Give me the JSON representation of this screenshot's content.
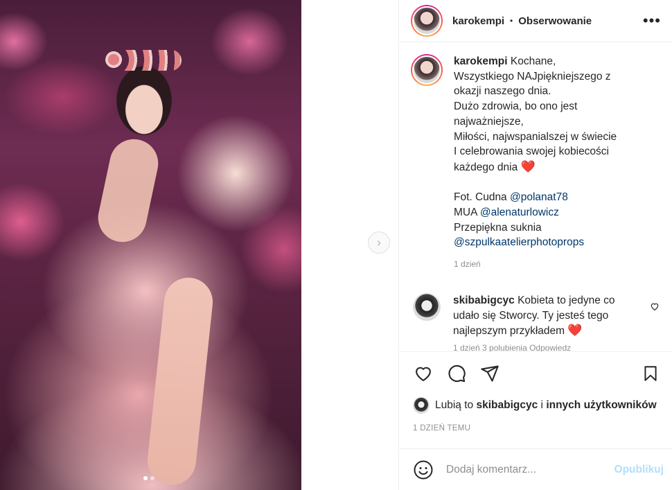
{
  "post": {
    "author": "karokempi",
    "follow_label": "Obserwowanie",
    "separator": "•",
    "more": "•••",
    "caption_lines": [
      "Kochane,",
      "Wszystkiego NAJpiękniejszego z",
      "okazji naszego dnia.",
      "Dużo zdrowia, bo ono jest",
      "najważniejsze,",
      "Miłości, najwspanialszej w świecie",
      "I celebrowania swojej kobiecości",
      "każdego dnia"
    ],
    "heart_emoji": "❤️",
    "credits": {
      "photo_prefix": "Fot. Cudna",
      "photo_mention": "@polanat78",
      "mua_prefix": "MUA",
      "mua_mention": "@alenaturlowicz",
      "dress_line": "Przepiękna suknia",
      "dress_mention": "@szpulkaatelierphotoprops"
    },
    "time_ago": "1 dzień"
  },
  "comment": {
    "author": "skibabigcyc",
    "text_lines": [
      "Kobieta to jedyne co",
      "udało się Stworcy. Ty jesteś tego",
      "najlepszym przykładem"
    ],
    "heart_emoji": "❤️",
    "meta": "1 dzień   3 polubienia   Odpowiedz"
  },
  "likes": {
    "prefix": "Lubią to",
    "user": "skibabigcyc",
    "connector": "i",
    "others": "innych użytkowników"
  },
  "date_label": "1 DZIEŃ TEMU",
  "add_comment": {
    "placeholder": "Dodaj komentarz...",
    "publish_label": "Opublikuj"
  },
  "carousel": {
    "slides": 2,
    "active": 1
  },
  "colors": {
    "link": "#00376b",
    "muted": "#8e8e8e",
    "publish_disabled": "#b2dffc",
    "heart": "#e3232c"
  }
}
